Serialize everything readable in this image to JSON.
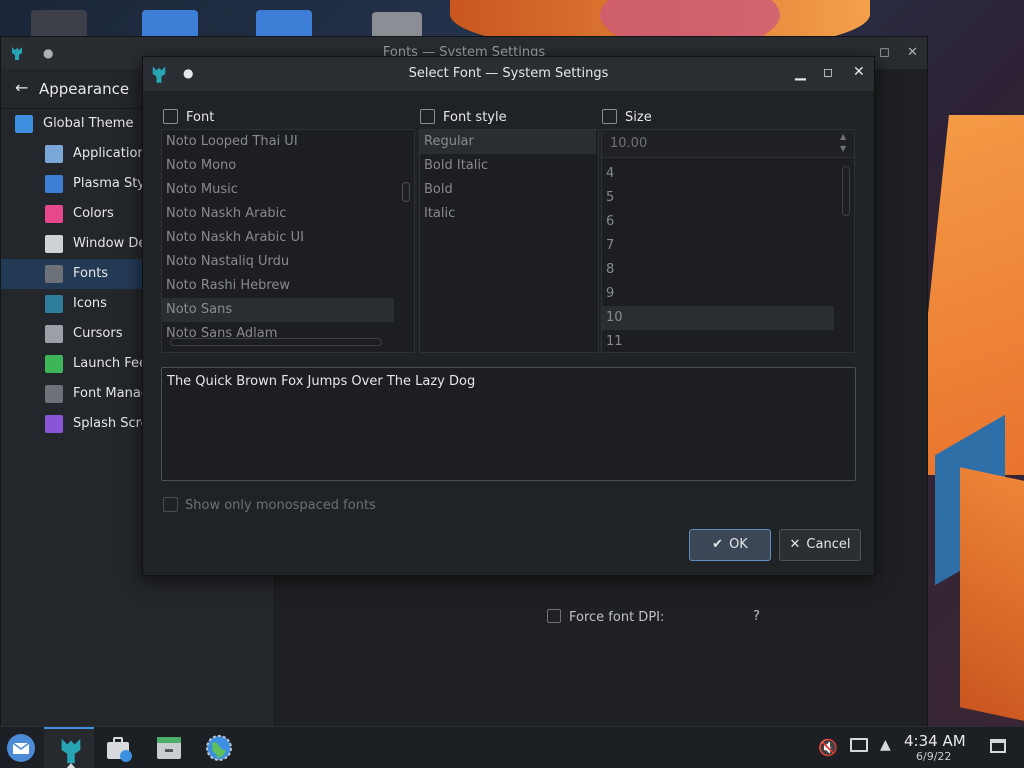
{
  "background_window": {
    "title": "Fonts — System Settings",
    "sidebar_title": "Appearance",
    "sidebar_items": [
      {
        "label": "Global Theme",
        "icon": "global-theme-icon",
        "color": "#3d8fe0"
      },
      {
        "label": "Application Style",
        "icon": "application-style-icon",
        "color": "#7aa6d8"
      },
      {
        "label": "Plasma Style",
        "icon": "plasma-style-icon",
        "color": "#3d7fd6"
      },
      {
        "label": "Colors",
        "icon": "colors-icon",
        "color": "#e5498c"
      },
      {
        "label": "Window Decorations",
        "icon": "window-decorations-icon",
        "color": "#cfd2d5"
      },
      {
        "label": "Fonts",
        "icon": "fonts-icon",
        "color": "#6d7278"
      },
      {
        "label": "Icons",
        "icon": "icons-icon",
        "color": "#2e7d9c"
      },
      {
        "label": "Cursors",
        "icon": "cursors-icon",
        "color": "#9aa0a6"
      },
      {
        "label": "Launch Feedback",
        "icon": "launch-feedback-icon",
        "color": "#3fb55a"
      },
      {
        "label": "Font Management",
        "icon": "font-management-icon",
        "color": "#6d7278"
      },
      {
        "label": "Splash Screen",
        "icon": "splash-screen-icon",
        "color": "#8a56d8"
      }
    ],
    "force_dpi_label": "Force font DPI:",
    "force_dpi_help": "?"
  },
  "dialog": {
    "title": "Select Font — System Settings",
    "font_header": "Font",
    "style_header": "Font style",
    "size_header": "Size",
    "fonts": [
      "Noto Looped Thai UI",
      "Noto Mono",
      "Noto Music",
      "Noto Naskh Arabic",
      "Noto Naskh Arabic UI",
      "Noto Nastaliq Urdu",
      "Noto Rashi Hebrew",
      "Noto Sans",
      "Noto Sans Adlam"
    ],
    "selected_font": "Noto Sans",
    "styles": [
      "Regular",
      "Bold Italic",
      "Bold",
      "Italic"
    ],
    "selected_style": "Regular",
    "size_value": "10.00",
    "sizes": [
      "4",
      "5",
      "6",
      "7",
      "8",
      "9",
      "10",
      "11"
    ],
    "selected_size": "10",
    "preview_text": "The Quick Brown Fox Jumps Over The Lazy Dog",
    "mono_label": "Show only monospaced fonts",
    "ok_label": "OK",
    "cancel_label": "Cancel"
  },
  "taskbar": {
    "time": "4:34 AM",
    "date": "6/9/22"
  },
  "colors": {
    "accent": "#3d8fe0",
    "dialog_bg": "#202326",
    "ok_border": "#5e8dbf"
  }
}
